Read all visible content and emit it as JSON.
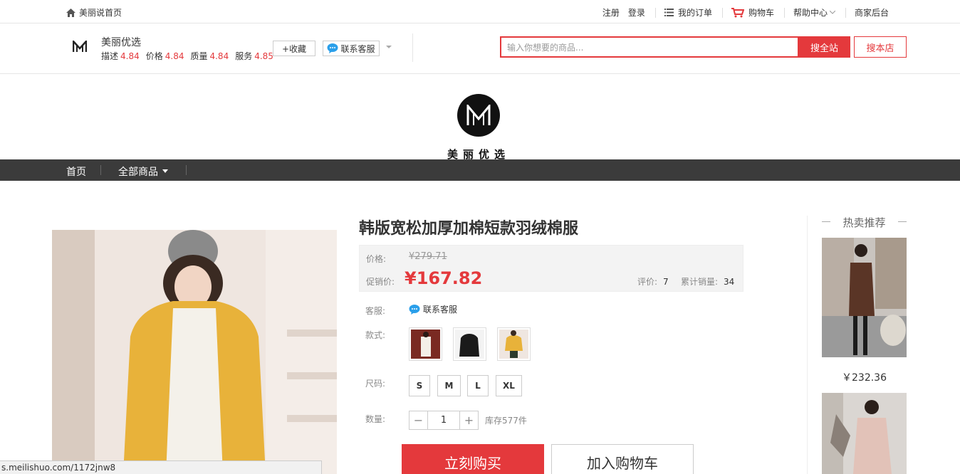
{
  "topbar": {
    "home_label": "美丽说首页",
    "register": "注册",
    "login": "登录",
    "orders": "我的订单",
    "cart": "购物车",
    "help": "帮助中心",
    "seller": "商家后台"
  },
  "shop": {
    "name": "美丽优选",
    "scores": [
      {
        "label": "描述",
        "value": "4.84"
      },
      {
        "label": "价格",
        "value": "4.84"
      },
      {
        "label": "质量",
        "value": "4.84"
      },
      {
        "label": "服务",
        "value": "4.85"
      }
    ],
    "fav_label": "+收藏",
    "cs_label": "联系客服"
  },
  "search": {
    "placeholder": "输入你想要的商品...",
    "search_all": "搜全站",
    "search_shop": "搜本店"
  },
  "banner": {
    "name": "美丽优选"
  },
  "nav": {
    "home": "首页",
    "all": "全部商品"
  },
  "product": {
    "title": "韩版宽松加厚加棉短款羽绒棉服",
    "price_label": "价格:",
    "original_price": "¥279.71",
    "promo_label": "促销价:",
    "promo_price": "¥167.82",
    "reviews_label": "评价:",
    "reviews": "7",
    "sales_label": "累计销量:",
    "sales": "34",
    "cs_row_label": "客服:",
    "cs_link": "联系客服",
    "style_label": "款式:",
    "size_label": "尺码:",
    "sizes": [
      "S",
      "M",
      "L",
      "XL"
    ],
    "qty_label": "数量:",
    "qty_minus": "−",
    "qty": "1",
    "qty_plus": "+",
    "stock": "库存577件",
    "buy_now": "立刻购买",
    "add_cart": "加入购物车"
  },
  "hot": {
    "title": "热卖推荐",
    "items": [
      {
        "price": "￥232.36"
      }
    ]
  },
  "statusbar": {
    "url": "s.meilishuo.com/1172jnw8"
  },
  "colors": {
    "accent": "#e4393c",
    "nav_bg": "#3b3b3b"
  }
}
